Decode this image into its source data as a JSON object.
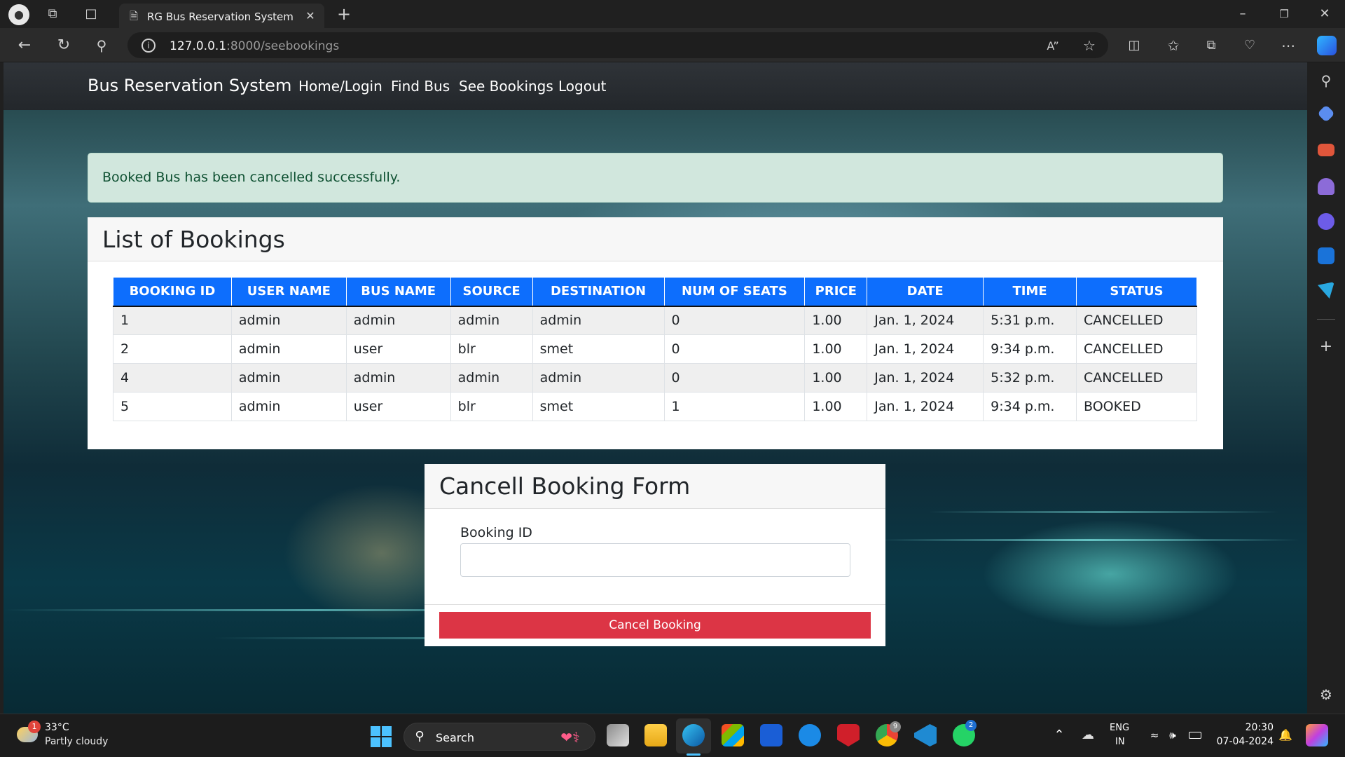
{
  "browser": {
    "tab_title": "RG Bus Reservation System",
    "url_host": "127.0.0.1",
    "url_path": ":8000/seebookings"
  },
  "navbar": {
    "brand": "Bus Reservation System",
    "links": [
      "Home/Login",
      "Find Bus",
      "See Bookings",
      "Logout"
    ]
  },
  "alert": {
    "message": "Booked Bus has been cancelled successfully."
  },
  "bookings": {
    "title": "List of Bookings",
    "columns": [
      "BOOKING ID",
      "USER NAME",
      "BUS NAME",
      "SOURCE",
      "DESTINATION",
      "NUM OF SEATS",
      "PRICE",
      "DATE",
      "TIME",
      "STATUS"
    ],
    "rows": [
      [
        "1",
        "admin",
        "admin",
        "admin",
        "admin",
        "0",
        "1.00",
        "Jan. 1, 2024",
        "5:31 p.m.",
        "CANCELLED"
      ],
      [
        "2",
        "admin",
        "user",
        "blr",
        "smet",
        "0",
        "1.00",
        "Jan. 1, 2024",
        "9:34 p.m.",
        "CANCELLED"
      ],
      [
        "4",
        "admin",
        "admin",
        "admin",
        "admin",
        "0",
        "1.00",
        "Jan. 1, 2024",
        "5:32 p.m.",
        "CANCELLED"
      ],
      [
        "5",
        "admin",
        "user",
        "blr",
        "smet",
        "1",
        "1.00",
        "Jan. 1, 2024",
        "9:34 p.m.",
        "BOOKED"
      ]
    ]
  },
  "cancel_form": {
    "title": "Cancell Booking Form",
    "label": "Booking ID",
    "input_value": "",
    "button": "Cancel Booking"
  },
  "taskbar": {
    "weather_temp": "33°C",
    "weather_desc": "Partly cloudy",
    "weather_badge": "1",
    "search_label": "Search",
    "lang_line1": "ENG",
    "lang_line2": "IN",
    "time": "20:30",
    "date": "07-04-2024",
    "chrome_badge": "9",
    "whatsapp_badge": "2"
  },
  "colors": {
    "primary": "#0d6efd",
    "danger": "#dc3545",
    "success_bg": "#d1e7dd",
    "success_text": "#0f5132",
    "navbar": "#2b2f33"
  }
}
